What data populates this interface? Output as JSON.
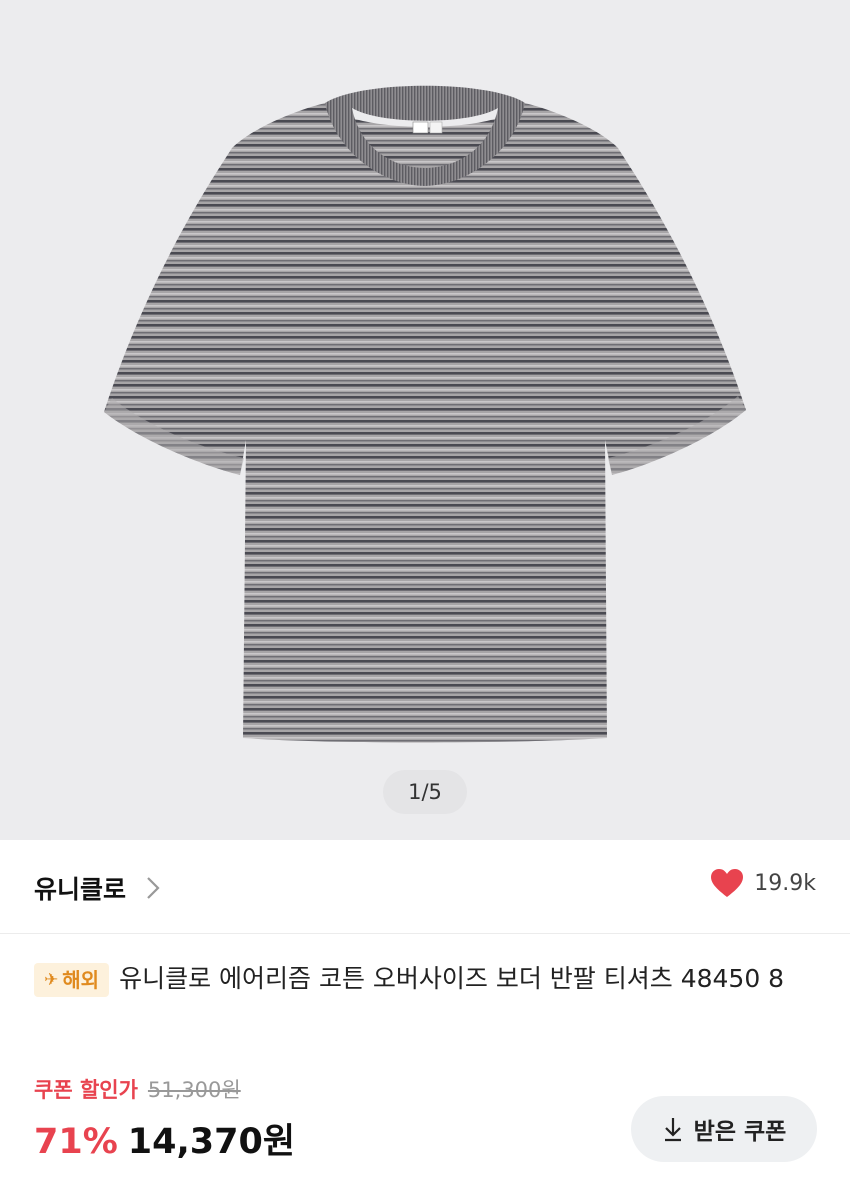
{
  "gallery": {
    "image_alt": "striped short sleeve t-shirt",
    "counter": "1/5"
  },
  "brand": {
    "name": "유니클로",
    "likes": "19.9k"
  },
  "product": {
    "tag": "해외",
    "title": "유니클로 에어리즘 코튼 오버사이즈 보더 반팔 티셔츠 48450 8"
  },
  "pricing": {
    "coupon_label": "쿠폰 할인가",
    "original_price": "51,300원",
    "discount_rate": "71%",
    "final_price": "14,370원",
    "coupon_button": "받은 쿠폰"
  },
  "colors": {
    "accent_red": "#e8434f",
    "tag_orange": "#e08a1e",
    "tag_bg": "#fdf1dc",
    "gallery_bg": "#ececee"
  },
  "icons": {
    "brand_arrow": "chevron-right-icon",
    "like": "heart-icon",
    "tag": "airplane-icon",
    "coupon": "download-icon"
  }
}
